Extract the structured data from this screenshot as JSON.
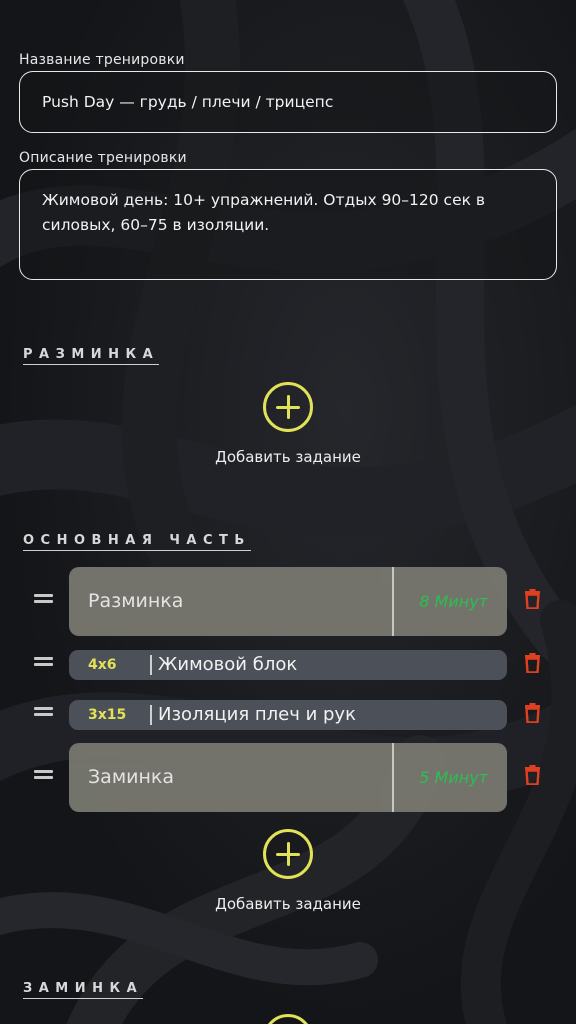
{
  "form": {
    "title_label": "Название тренировки",
    "title_value": "Push Day — грудь / плечи / трицепс",
    "desc_label": "Описание тренировки",
    "desc_value": "Жимовой день: 10+ упражнений. Отдых 90–120 сек в силовых, 60–75 в изоляции."
  },
  "sections": {
    "warmup_title": "РАЗМИНКА",
    "main_title": "ОСНОВНАЯ ЧАСТЬ",
    "cooldown_title": "ЗАМИНКА"
  },
  "add_task_label": "Добавить задание",
  "main_items": [
    {
      "type": "block",
      "name": "Разминка",
      "duration": "8 Минут"
    },
    {
      "type": "exercise",
      "sets": "4x6",
      "name": "Жимовой блок"
    },
    {
      "type": "exercise",
      "sets": "3x15",
      "name": "Изоляция плеч и рук"
    },
    {
      "type": "block",
      "name": "Заминка",
      "duration": "5 Минут"
    }
  ],
  "colors": {
    "accent_yellow": "#e1e257",
    "duration_green": "#2ecc54",
    "delete_red": "#e0401f",
    "block_card": "#7b7b72",
    "exercise_card": "#4c5058"
  },
  "icons": {
    "add": "plus-circle-icon",
    "drag": "drag-handle-icon",
    "delete": "trash-icon"
  }
}
